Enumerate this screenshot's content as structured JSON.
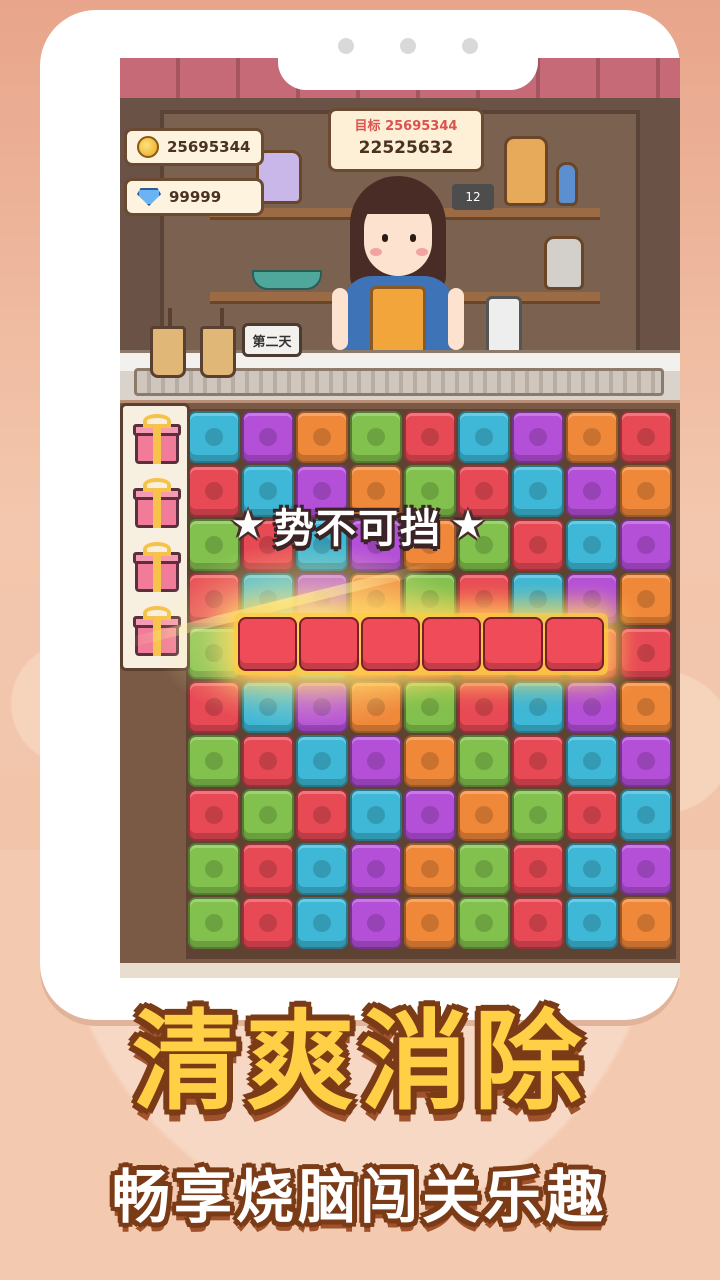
{
  "hud": {
    "coins": "25695344",
    "gems": "99999",
    "target_label": "目标 25695344",
    "score": "22525632",
    "day_label": "第二天",
    "clock_label": "12"
  },
  "combo": {
    "text": "势不可挡"
  },
  "board": {
    "rows": [
      [
        "blue",
        "purple",
        "orange",
        "green",
        "red",
        "blue",
        "purple",
        "orange",
        "red"
      ],
      [
        "red",
        "blue",
        "purple",
        "orange",
        "green",
        "red",
        "blue",
        "purple",
        "orange"
      ],
      [
        "green",
        "red",
        "blue",
        "purple",
        "orange",
        "green",
        "red",
        "blue",
        "purple"
      ],
      [
        "red",
        "blue",
        "purple",
        "orange",
        "green",
        "red",
        "blue",
        "purple",
        "orange"
      ],
      [
        "green",
        "red",
        "blue",
        "red",
        "red",
        "red",
        "red",
        "red",
        "red"
      ],
      [
        "red",
        "blue",
        "purple",
        "orange",
        "green",
        "red",
        "blue",
        "purple",
        "orange"
      ],
      [
        "green",
        "red",
        "blue",
        "purple",
        "orange",
        "green",
        "red",
        "blue",
        "purple"
      ],
      [
        "red",
        "green",
        "red",
        "blue",
        "purple",
        "orange",
        "green",
        "red",
        "blue"
      ],
      [
        "green",
        "red",
        "blue",
        "purple",
        "orange",
        "green",
        "red",
        "blue",
        "purple"
      ],
      [
        "green",
        "red",
        "blue",
        "purple",
        "orange",
        "green",
        "red",
        "blue",
        "orange"
      ]
    ],
    "highlighted_row_tiles": 6
  },
  "gifts": {
    "count": 4
  },
  "promo": {
    "headline": "清爽消除",
    "subline": "畅享烧脑闯关乐趣"
  },
  "colors": {
    "red": "#e84a55",
    "blue": "#3fb7d6",
    "purple": "#b44fd8",
    "orange": "#f0883a",
    "green": "#82c14e",
    "headline": "#ffd046"
  }
}
